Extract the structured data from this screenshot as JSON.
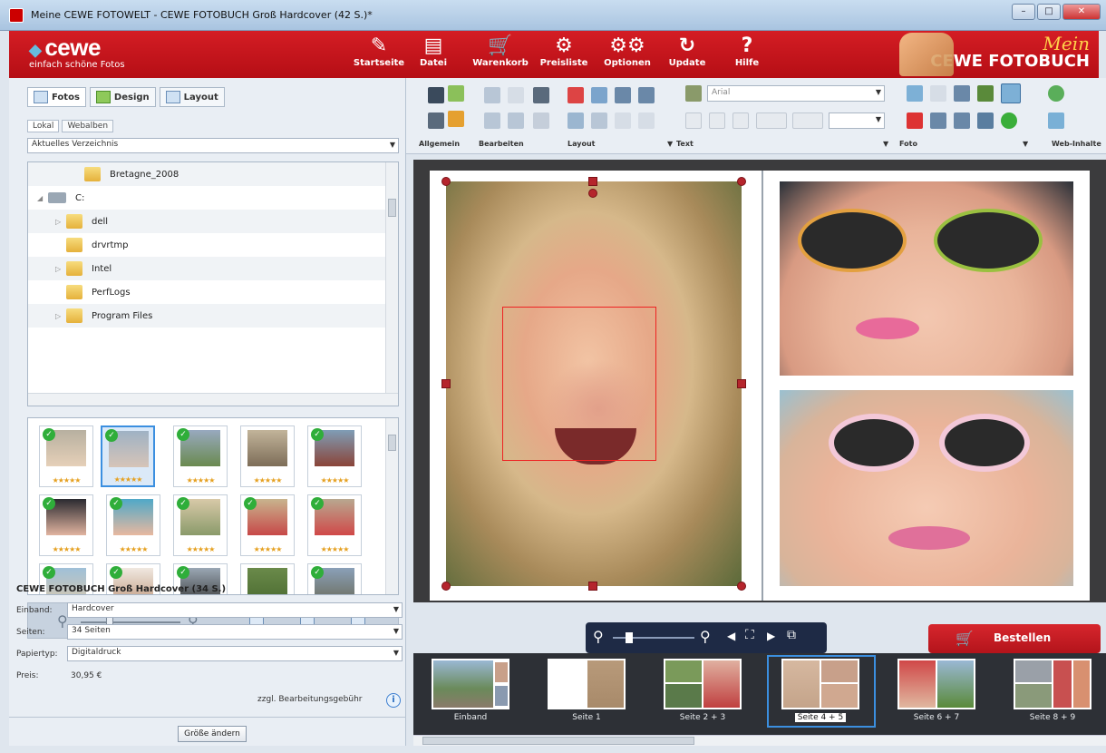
{
  "window": {
    "title": "Meine CEWE FOTOWELT - CEWE FOTOBUCH Groß Hardcover (42 S.)*"
  },
  "brand": {
    "name": "cewe",
    "tagline": "einfach schöne Fotos",
    "right_top": "Mein",
    "right_bottom": "CEWE FOTOBUCH"
  },
  "nav": [
    {
      "label": "Startseite",
      "icon": "home-icon"
    },
    {
      "label": "Datei",
      "icon": "file-icon"
    },
    {
      "label": "Warenkorb",
      "icon": "cart-icon"
    },
    {
      "label": "Preisliste",
      "icon": "price-list-icon"
    },
    {
      "label": "Optionen",
      "icon": "options-gears-icon"
    },
    {
      "label": "Update",
      "icon": "update-icon"
    },
    {
      "label": "Hilfe",
      "icon": "help-icon"
    }
  ],
  "left": {
    "tabs": [
      "Fotos",
      "Design",
      "Layout"
    ],
    "subtabs": [
      "Lokal",
      "Webalben"
    ],
    "directory_dropdown": "Aktuelles Verzeichnis",
    "tree": [
      {
        "label": "Bretagne_2008",
        "indent": 3
      },
      {
        "label": "C:",
        "indent": 0
      },
      {
        "label": "dell",
        "indent": 1
      },
      {
        "label": "drvrtmp",
        "indent": 1
      },
      {
        "label": "Intel",
        "indent": 1
      },
      {
        "label": "PerfLogs",
        "indent": 1
      },
      {
        "label": "Program Files",
        "indent": 1
      }
    ],
    "star_text": "★★★★★"
  },
  "product": {
    "title": "CEWE FOTOBUCH Groß Hardcover (34 S.)",
    "einband_label": "Einband:",
    "einband_value": "Hardcover",
    "seiten_label": "Seiten:",
    "seiten_value": "34 Seiten",
    "papier_label": "Papiertyp:",
    "papier_value": "Digitaldruck",
    "preis_label": "Preis:",
    "preis_value": "30,95 €",
    "fee_note": "zzgl. Bearbeitungsgebühr",
    "resize_button": "Größe ändern"
  },
  "toolbar": {
    "groups": [
      "Allgemein",
      "Bearbeiten",
      "Layout",
      "Text",
      "Foto",
      "Web-Inhalte"
    ],
    "font": "Arial"
  },
  "order_button": "Bestellen",
  "pages": [
    {
      "label": "Einband",
      "selected": false
    },
    {
      "label": "Seite 1",
      "selected": false
    },
    {
      "label": "Seite 2 + 3",
      "selected": false
    },
    {
      "label": "Seite 4 + 5",
      "selected": true
    },
    {
      "label": "Seite 6 + 7",
      "selected": false
    },
    {
      "label": "Seite 8 + 9",
      "selected": false
    }
  ],
  "colors": {
    "brand_red": "#c3141b",
    "selection_blue": "#3b8fe0",
    "nav_dark": "#1e2a45"
  }
}
